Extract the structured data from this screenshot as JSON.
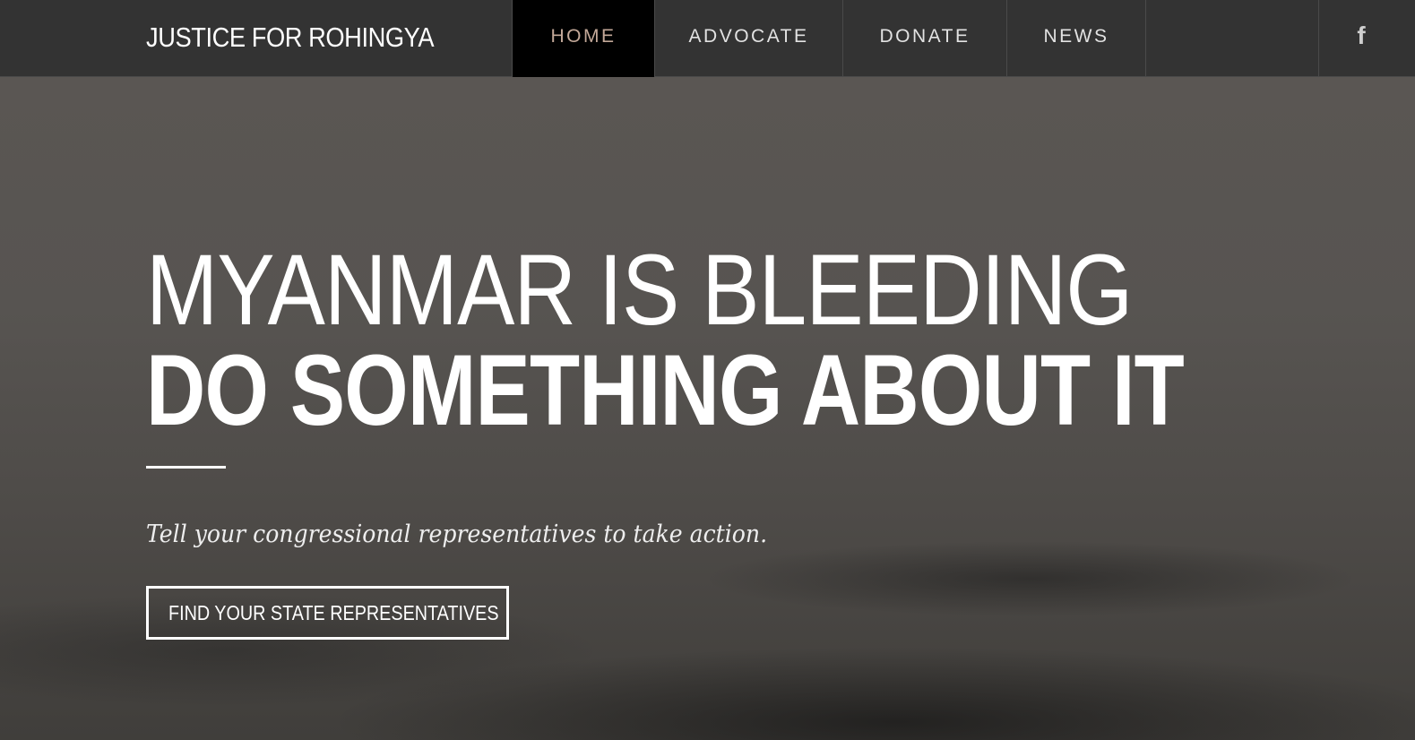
{
  "header": {
    "brand": "JUSTICE FOR ROHINGYA",
    "nav": [
      {
        "label": "HOME",
        "active": true
      },
      {
        "label": "ADVOCATE",
        "active": false
      },
      {
        "label": "DONATE",
        "active": false
      },
      {
        "label": "NEWS",
        "active": false
      }
    ],
    "social": {
      "icon": "facebook-icon",
      "glyph": "f"
    }
  },
  "hero": {
    "headline_line1": "MYANMAR IS BLEEDING",
    "headline_line2": "DO SOMETHING ABOUT IT",
    "tagline": "Tell your congressional representatives to take action.",
    "cta_label": "FIND YOUR STATE REPRESENTATIVES"
  },
  "colors": {
    "nav_background": "#333333",
    "nav_active_background": "#000000",
    "nav_active_text": "#c3a898",
    "hero_overlay": "#575451",
    "text": "#ffffff"
  }
}
